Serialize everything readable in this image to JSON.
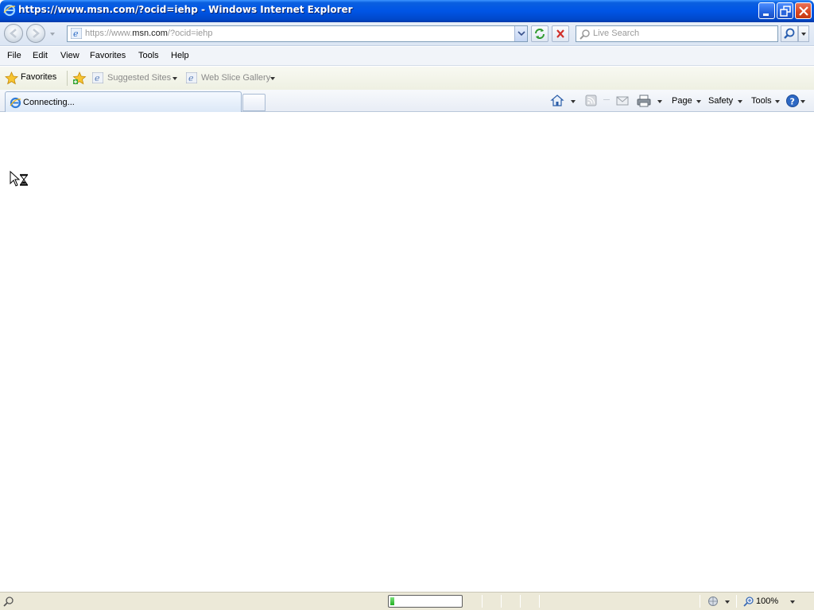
{
  "window": {
    "title": "https://www.msn.com/?ocid=iehp - Windows Internet Explorer"
  },
  "address_bar": {
    "url_prefix": "https://www.",
    "url_host": "msn.com",
    "url_suffix": "/?ocid=iehp"
  },
  "search": {
    "placeholder": "Live Search"
  },
  "menu": {
    "items": [
      "File",
      "Edit",
      "View",
      "Favorites",
      "Tools",
      "Help"
    ]
  },
  "favorites_bar": {
    "favorites_label": "Favorites",
    "links": [
      "Suggested Sites",
      "Web Slice Gallery"
    ]
  },
  "tabs": {
    "active_label": "Connecting..."
  },
  "command_bar": {
    "page_label": "Page",
    "safety_label": "Safety",
    "tools_label": "Tools"
  },
  "status_bar": {
    "progress_fraction": 0.06,
    "zoom": "100%"
  },
  "icons": {
    "app": "ie-logo-icon",
    "back": "back-arrow-icon",
    "forward": "forward-arrow-icon",
    "refresh": "refresh-icon",
    "stop": "stop-icon",
    "search": "magnifier-icon",
    "home": "home-icon",
    "feeds": "rss-feed-icon",
    "mail": "read-mail-icon",
    "print": "printer-icon",
    "help": "help-icon",
    "cursor": "busy-cursor-icon"
  },
  "colors": {
    "titlebar": "#0055e5",
    "close_button": "#d9461f",
    "progress_fill": "#23b023"
  }
}
